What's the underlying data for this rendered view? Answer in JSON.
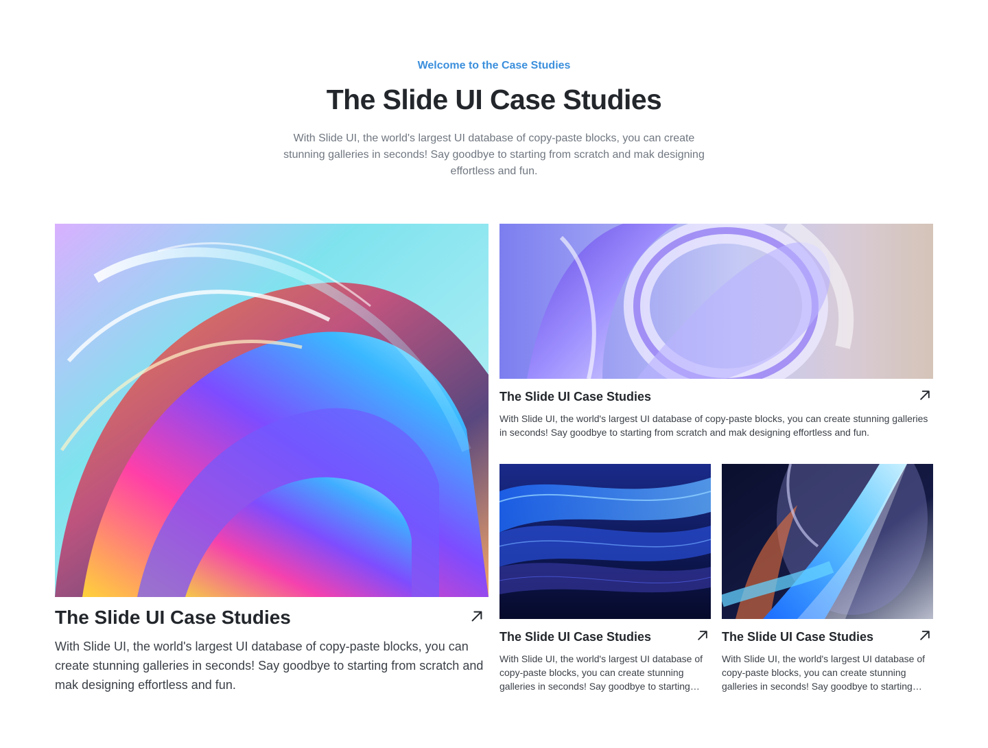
{
  "header": {
    "eyebrow": "Welcome to the Case Studies",
    "title": "The Slide UI Case Studies",
    "subtitle": "With Slide UI, the world's largest UI database of copy-paste blocks, you can create stunning galleries in seconds! Say goodbye to starting from scratch and mak designing effortless and fun."
  },
  "colors": {
    "accent": "#3b8fdc",
    "heading": "#23272c",
    "muted": "#707780"
  },
  "cards": [
    {
      "title": "The Slide UI Case Studies",
      "description": "With Slide UI, the world's largest UI database of copy-paste blocks, you can create stunning galleries in seconds! Say goodbye to starting from scratch and mak designing effortless and fun.",
      "icon": "arrow-up-right-icon"
    },
    {
      "title": "The Slide UI Case Studies",
      "description": "With Slide UI, the world's largest UI database of copy-paste blocks, you can create stunning galleries in seconds! Say goodbye to starting from scratch and mak designing effortless and fun.",
      "icon": "arrow-up-right-icon"
    },
    {
      "title": "The Slide UI Case Studies",
      "description": "With Slide UI, the world's largest UI database of copy-paste blocks, you can create stunning galleries in seconds! Say goodbye to starting from scratch and mak designing effortless and fun.",
      "icon": "arrow-up-right-icon"
    },
    {
      "title": "The Slide UI Case Studies",
      "description": "With Slide UI, the world's largest UI database of copy-paste blocks, you can create stunning galleries in seconds! Say goodbye to starting from scratch and mak designing effortless and fun.",
      "icon": "arrow-up-right-icon"
    }
  ]
}
